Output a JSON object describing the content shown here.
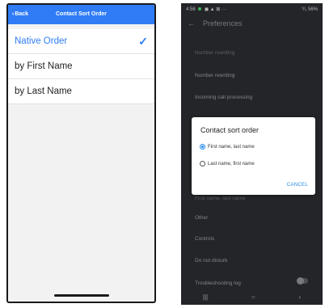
{
  "ios": {
    "nav": {
      "back_label": "Back",
      "title": "Contact Sort Order"
    },
    "rows": [
      {
        "label": "Native Order",
        "selected": true
      },
      {
        "label": "by First Name",
        "selected": false
      },
      {
        "label": "by Last Name",
        "selected": false
      }
    ],
    "check_glyph": "✓",
    "accent_color": "#2f7cf6"
  },
  "android": {
    "status": {
      "time": "4:56",
      "icons_left": "◼ ▲ ⊠",
      "more": "···",
      "right": "⁰⁄₀ 56%"
    },
    "appbar": {
      "back_icon": "←",
      "title": "Preferences"
    },
    "prefs": [
      "Number rewriting",
      "Number rewriting",
      "Incoming call processing",
      "Other",
      "Controls",
      "Do not disturb",
      "Troubleshooting log"
    ],
    "hidden_pref": "First name, last name",
    "dialog": {
      "title": "Contact sort order",
      "options": [
        {
          "label": "First name, last name",
          "selected": true
        },
        {
          "label": "Last name, first name",
          "selected": false
        }
      ],
      "cancel_label": "CANCEL"
    },
    "nav": {
      "recents": "|||",
      "home": "○",
      "back": "‹"
    },
    "accent_color": "#1e88e5"
  }
}
